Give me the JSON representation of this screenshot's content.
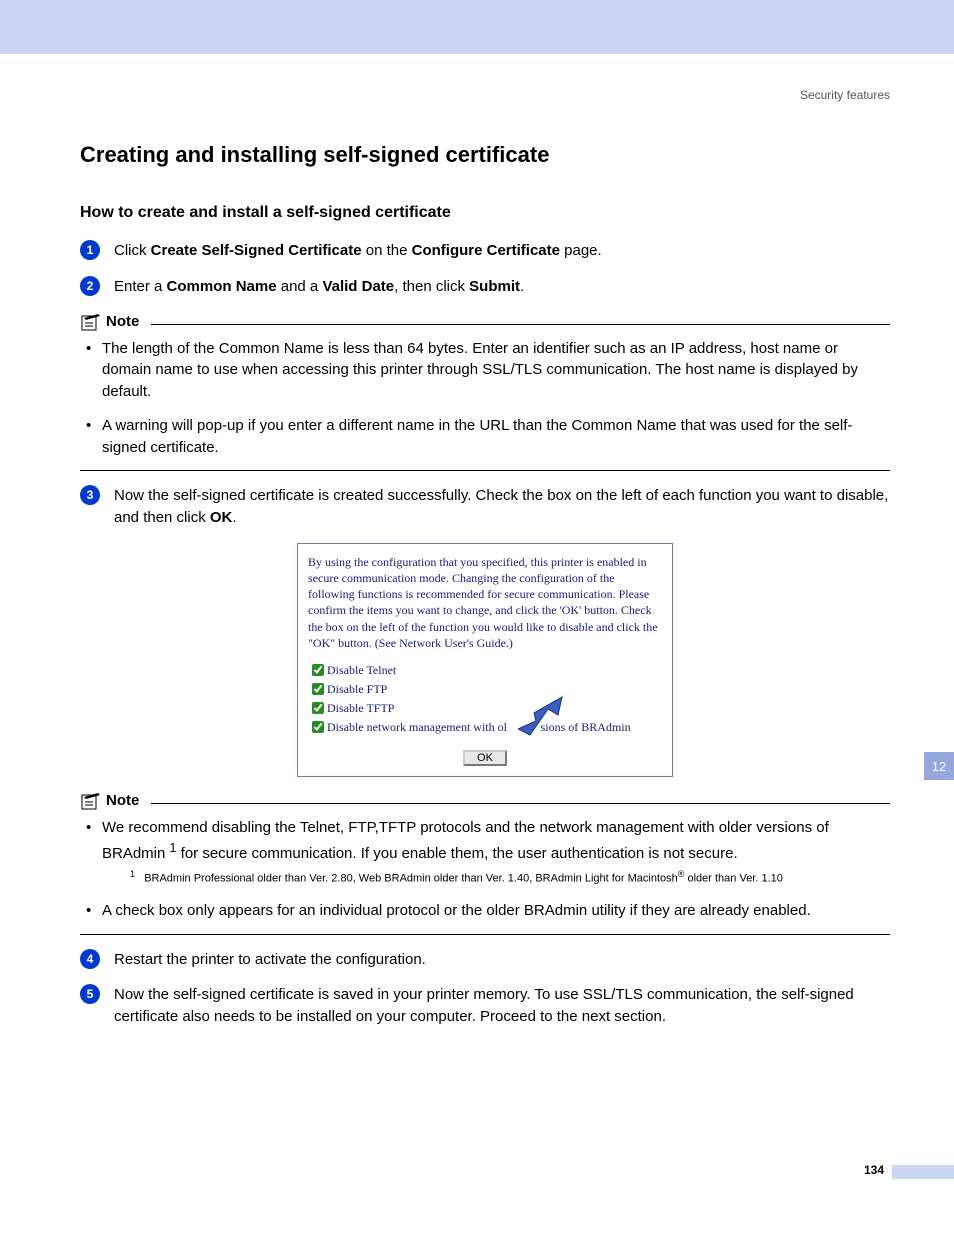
{
  "header": {
    "section_label": "Security features"
  },
  "title": "Creating and installing self-signed certificate",
  "subtitle": "How to create and install a self-signed certificate",
  "steps": {
    "s1": {
      "num": "1",
      "pre": "Click ",
      "b1": "Create Self-Signed Certificate",
      "mid": " on the ",
      "b2": "Configure Certificate",
      "post": " page."
    },
    "s2": {
      "num": "2",
      "pre": "Enter a ",
      "b1": "Common Name",
      "mid": " and a ",
      "b2": "Valid Date",
      "mid2": ", then click ",
      "b3": "Submit",
      "post": "."
    },
    "s3": {
      "num": "3",
      "body_pre": "Now the self-signed certificate is created successfully. Check the box on the left of each function you want to disable, and then click ",
      "b1": "OK",
      "post": "."
    },
    "s4": {
      "num": "4",
      "body": "Restart the printer to activate the configuration."
    },
    "s5": {
      "num": "5",
      "body": "Now the self-signed certificate is saved in your printer memory. To use SSL/TLS communication, the self-signed certificate also needs to be installed on your computer. Proceed to the next section."
    }
  },
  "note1": {
    "label": "Note",
    "b1_pre": "The length of the ",
    "b1_bold": "Common Name",
    "b1_post": " is less than 64 bytes. Enter an identifier such as an IP address, host name or domain name to use when accessing this printer through SSL/TLS communication. The host name is displayed by default.",
    "b2_pre": "A warning will pop-up if you enter a different name in the URL than the ",
    "b2_bold": "Common Name",
    "b2_post": " that was used for the self-signed certificate."
  },
  "dialog": {
    "desc": "By using the configuration that you specified, this printer is enabled in secure communication mode. Changing the configuration of the following functions is recommended for secure communication. Please confirm the items you want to change, and click the 'OK' button. Check the box on the left of the function you would like to disable and click the \"OK\" button. (See Network User's Guide.)",
    "opt1": "Disable Telnet",
    "opt2": "Disable FTP",
    "opt3": "Disable TFTP",
    "opt4_pre": "Disable network management with ol",
    "opt4_post": "sions of BRAdmin",
    "ok": "OK"
  },
  "note2": {
    "label": "Note",
    "b1_pre": "We recommend disabling the Telnet, FTP,TFTP protocols and the network management with older versions of BRAdmin ",
    "b1_sup": "1",
    "b1_post": " for secure communication. If you enable them, the user authentication is not secure.",
    "footnote_num": "1",
    "footnote_pre": "BRAdmin Professional older than Ver. 2.80, Web BRAdmin older than Ver. 1.40, BRAdmin Light for Macintosh",
    "footnote_sup": "®",
    "footnote_post": " older than Ver. 1.10",
    "b2": "A check box only appears for an individual protocol or the older BRAdmin utility if they are already enabled."
  },
  "side_tab": "12",
  "page_number": "134"
}
